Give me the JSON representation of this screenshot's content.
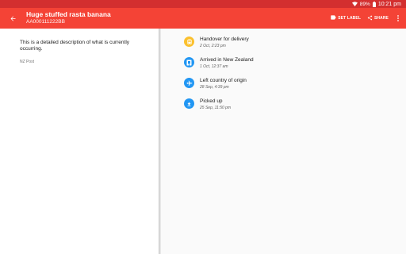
{
  "status_bar": {
    "battery": "89%",
    "time": "10:21 pm"
  },
  "app_bar": {
    "title": "Huge stuffed rasta banana",
    "tracking_number": "AA000111222BB",
    "actions": {
      "set_label": "SET LABEL",
      "share": "SHARE"
    }
  },
  "detail": {
    "description": "This is a detailed description of what is currently occurring.",
    "carrier": "NZ Post"
  },
  "events": [
    {
      "title": "Handover for delivery",
      "time": "2 Oct, 2:23 pm",
      "icon": "bus-icon",
      "color": "#fbc02d"
    },
    {
      "title": "Arrived in New Zealand",
      "time": "1 Oct, 12:37 am",
      "icon": "building-icon",
      "color": "#2196f3"
    },
    {
      "title": "Left country of origin",
      "time": "28 Sep, 4:39 pm",
      "icon": "airplane-icon",
      "color": "#2196f3"
    },
    {
      "title": "Picked up",
      "time": "25 Sep, 11:50 pm",
      "icon": "upload-icon",
      "color": "#2196f3"
    }
  ],
  "colors": {
    "primary": "#f44336",
    "primary_dark": "#d32f2f",
    "accent_blue": "#2196f3",
    "accent_yellow": "#fbc02d"
  }
}
